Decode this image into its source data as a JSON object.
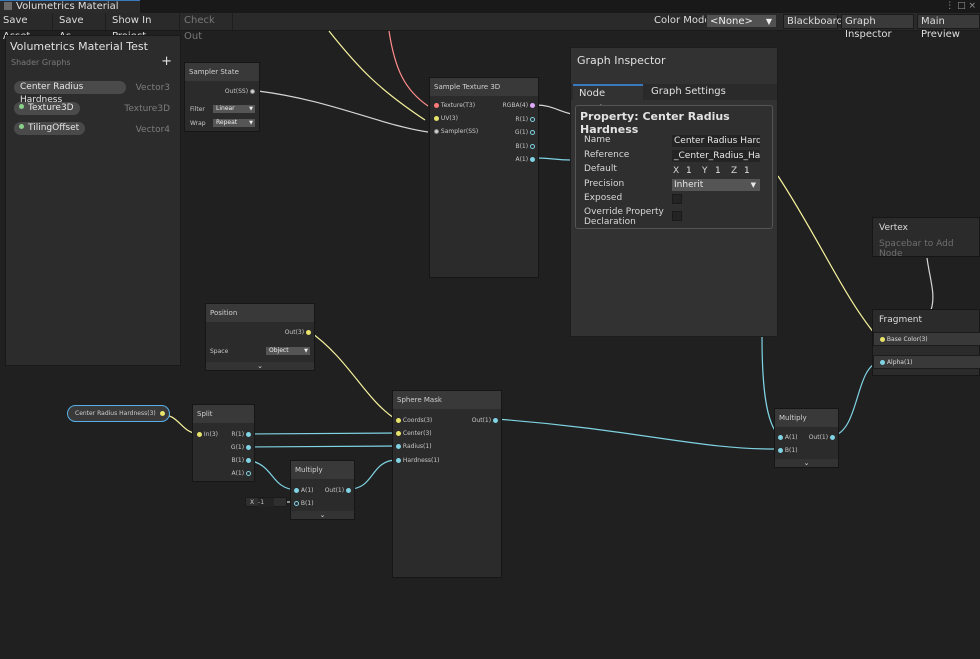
{
  "window_tab": {
    "title": "Volumetrics Material Test*",
    "controls": "⋮ □ ×"
  },
  "toolbar": {
    "save_asset": "Save Asset",
    "save_as": "Save As...",
    "show_in_project": "Show In Project",
    "check_out": "Check Out",
    "color_mode_label": "Color Mode",
    "color_mode_value": "<None>",
    "blackboard": "Blackboard",
    "graph_inspector": "Graph Inspector",
    "main_preview": "Main Preview"
  },
  "blackboard": {
    "title": "Volumetrics Material Test",
    "subtitle": "Shader Graphs",
    "add": "+",
    "properties": [
      {
        "name": "Center Radius Hardness",
        "type": "Vector3"
      },
      {
        "name": "Texture3D",
        "type": "Texture3D"
      },
      {
        "name": "TilingOffset",
        "type": "Vector4"
      }
    ]
  },
  "nodes": {
    "sampler_state": {
      "title": "Sampler State",
      "out": "Out(SS)",
      "filter_label": "Filter",
      "filter_value": "Linear",
      "wrap_label": "Wrap",
      "wrap_value": "Repeat"
    },
    "sample_texture_3d": {
      "title": "Sample Texture 3D",
      "in_texture": "Texture(T3)",
      "in_uv": "UV(3)",
      "in_sampler": "Sampler(SS)",
      "out_rgba": "RGBA(4)",
      "out_r": "R(1)",
      "out_g": "G(1)",
      "out_b": "B(1)",
      "out_a": "A(1)"
    },
    "position": {
      "title": "Position",
      "out": "Out(3)",
      "space_label": "Space",
      "space_value": "Object"
    },
    "property_node": {
      "label": "Center Radius Hardness(3)"
    },
    "split": {
      "title": "Split",
      "in": "In(3)",
      "r": "R(1)",
      "g": "G(1)",
      "b": "B(1)",
      "a": "A(1)"
    },
    "multiply_small": {
      "title": "Multiply",
      "in_a": "A(1)",
      "in_b": "B(1)",
      "out": "Out(1)",
      "const_x_label": "X",
      "const_x_value": "-1"
    },
    "sphere_mask": {
      "title": "Sphere Mask",
      "coords": "Coords(3)",
      "center": "Center(3)",
      "radius": "Radius(1)",
      "hardness": "Hardness(1)",
      "out": "Out(1)"
    },
    "multiply_right": {
      "title": "Multiply",
      "in_a": "A(1)",
      "in_b": "B(1)",
      "out": "Out(1)"
    },
    "vertex": {
      "title": "Vertex",
      "hint": "Spacebar to Add Node"
    },
    "fragment": {
      "title": "Fragment",
      "base_color": "Base Color(3)",
      "alpha": "Alpha(1)"
    },
    "expand": "⌄"
  },
  "graph_inspector": {
    "title": "Graph Inspector",
    "tabs": [
      "Node Settings",
      "Graph Settings"
    ],
    "property_title": "Property: Center Radius Hardness",
    "name_label": "Name",
    "name_value": "Center Radius Hardness",
    "reference_label": "Reference",
    "reference_value": "_Center_Radius_Hardness",
    "default_label": "Default",
    "default_x_label": "X",
    "default_x": "1",
    "default_y_label": "Y",
    "default_y": "1",
    "default_z_label": "Z",
    "default_z": "1",
    "precision_label": "Precision",
    "precision_value": "Inherit",
    "exposed_label": "Exposed",
    "override_label": "Override Property Declaration"
  },
  "colors": {
    "accent": "#3a79bb",
    "float_wire": "#7fd3e3",
    "vector3_wire": "#f6f29c",
    "texture_wire": "#ff8b8b"
  }
}
